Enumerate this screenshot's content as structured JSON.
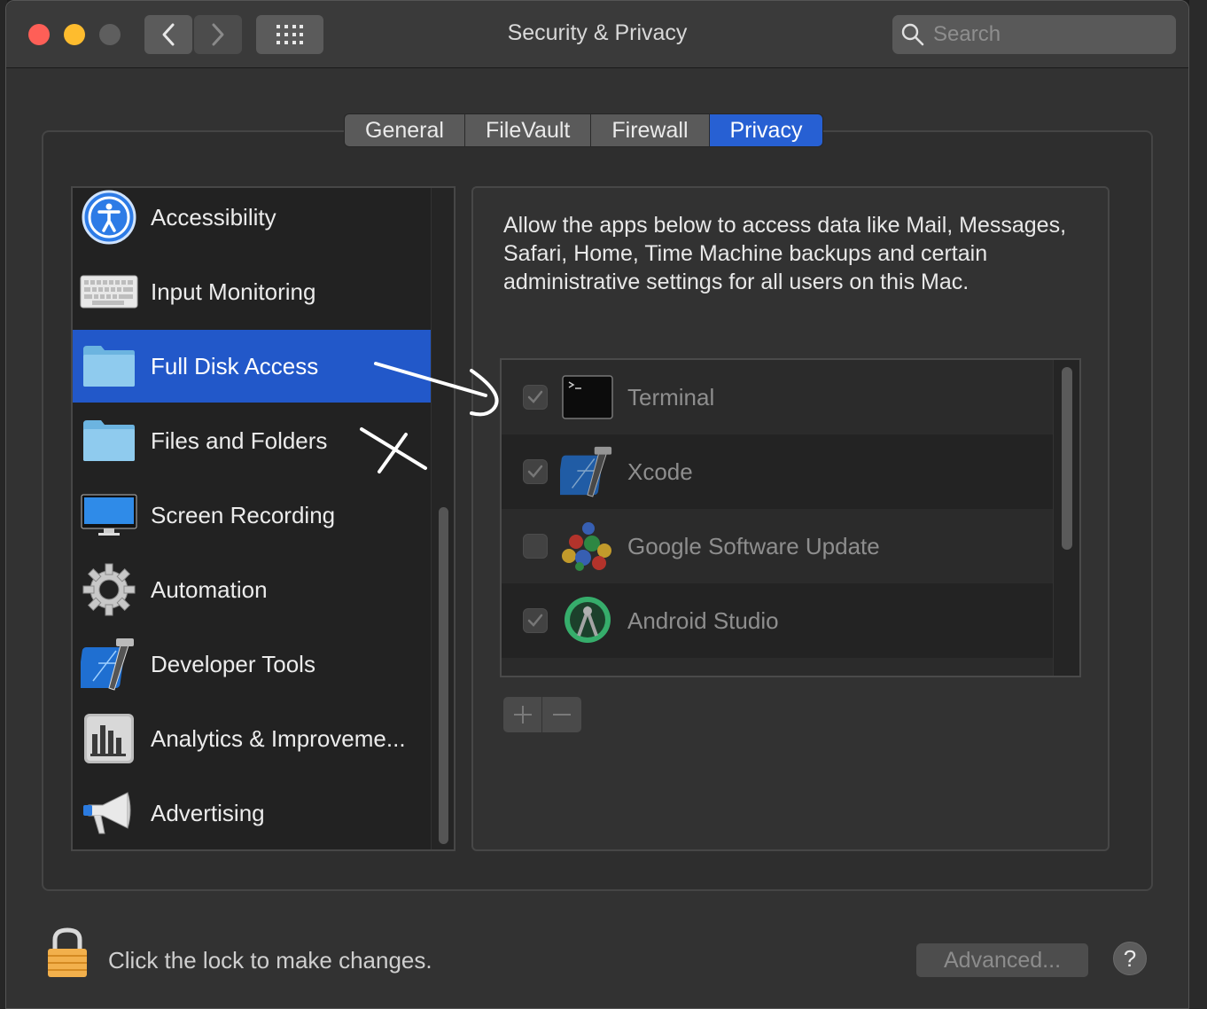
{
  "window": {
    "title": "Security & Privacy"
  },
  "search": {
    "placeholder": "Search"
  },
  "tabs": [
    {
      "label": "General",
      "active": false
    },
    {
      "label": "FileVault",
      "active": false
    },
    {
      "label": "Firewall",
      "active": false
    },
    {
      "label": "Privacy",
      "active": true
    }
  ],
  "categories": [
    {
      "label": "Accessibility",
      "icon": "accessibility-icon"
    },
    {
      "label": "Input Monitoring",
      "icon": "keyboard-icon"
    },
    {
      "label": "Full Disk Access",
      "icon": "folder-icon",
      "selected": true
    },
    {
      "label": "Files and Folders",
      "icon": "folder-icon"
    },
    {
      "label": "Screen Recording",
      "icon": "display-icon"
    },
    {
      "label": "Automation",
      "icon": "gear-icon"
    },
    {
      "label": "Developer Tools",
      "icon": "xcode-icon"
    },
    {
      "label": "Analytics & Improveme...",
      "icon": "analytics-icon"
    },
    {
      "label": "Advertising",
      "icon": "megaphone-icon"
    }
  ],
  "privacy": {
    "description": "Allow the apps below to access data like Mail, Messages, Safari, Home, Time Machine backups and certain administrative settings for all users on this Mac.",
    "apps": [
      {
        "name": "Terminal",
        "checked": true,
        "icon": "terminal-icon"
      },
      {
        "name": "Xcode",
        "checked": true,
        "icon": "xcode-icon"
      },
      {
        "name": "Google Software Update",
        "checked": false,
        "icon": "google-update-icon"
      },
      {
        "name": "Android Studio",
        "checked": true,
        "icon": "android-studio-icon"
      }
    ]
  },
  "footer": {
    "lock_text": "Click the lock to make changes.",
    "advanced_label": "Advanced...",
    "help_label": "?"
  },
  "colors": {
    "accent": "#2760d3",
    "selection": "#2258c9"
  }
}
